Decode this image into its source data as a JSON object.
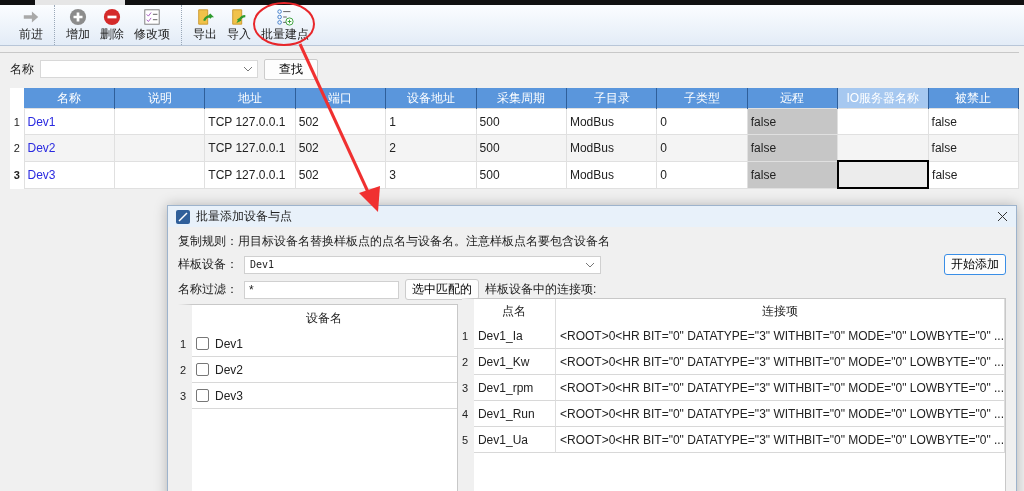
{
  "toolbar": {
    "groups": [
      [
        {
          "label": "前进",
          "kind": "forward"
        }
      ],
      [
        {
          "label": "增加",
          "kind": "add"
        },
        {
          "label": "删除",
          "kind": "delete"
        },
        {
          "label": "修改项",
          "kind": "edit"
        }
      ],
      [
        {
          "label": "导出",
          "kind": "export"
        },
        {
          "label": "导入",
          "kind": "import"
        },
        {
          "label": "批量建点",
          "kind": "batch"
        }
      ]
    ]
  },
  "search": {
    "label": "名称",
    "button": "查找"
  },
  "table": {
    "columns": [
      {
        "label": "名称",
        "selected": false
      },
      {
        "label": "说明",
        "selected": false
      },
      {
        "label": "地址",
        "selected": false
      },
      {
        "label": "端口",
        "selected": false
      },
      {
        "label": "设备地址",
        "selected": false
      },
      {
        "label": "采集周期",
        "selected": false
      },
      {
        "label": "子目录",
        "selected": false
      },
      {
        "label": "子类型",
        "selected": false
      },
      {
        "label": "远程",
        "selected": false
      },
      {
        "label": "IO服务器名称",
        "selected": true
      },
      {
        "label": "被禁止",
        "selected": false
      }
    ],
    "rows": [
      {
        "number": "1",
        "current": false,
        "cells": [
          "Dev1",
          "",
          "TCP 127.0.0.1",
          "502",
          "1",
          "500",
          "ModBus",
          "0",
          "false",
          "",
          "false"
        ]
      },
      {
        "number": "2",
        "current": false,
        "cells": [
          "Dev2",
          "",
          "TCP 127.0.0.1",
          "502",
          "2",
          "500",
          "ModBus",
          "0",
          "false",
          "",
          "false"
        ]
      },
      {
        "number": "3",
        "current": true,
        "cells": [
          "Dev3",
          "",
          "TCP 127.0.0.1",
          "502",
          "3",
          "500",
          "ModBus",
          "0",
          "false",
          "",
          "false"
        ]
      }
    ]
  },
  "dialog": {
    "title": "批量添加设备与点",
    "rule": "复制规则：用目标设备名替换样板点的点名与设备名。注意样板点名要包含设备名",
    "template_label": "样板设备：",
    "template_value": "Dev1",
    "start_button": "开始添加",
    "filter_label": "名称过滤：",
    "filter_value": "*",
    "select_button": "选中匹配的",
    "points_label": "样板设备中的连接项:",
    "devices": {
      "column": "设备名",
      "rows": [
        {
          "number": "1",
          "name": "Dev1",
          "checked": false
        },
        {
          "number": "2",
          "name": "Dev2",
          "checked": false
        },
        {
          "number": "3",
          "name": "Dev3",
          "checked": false
        }
      ]
    },
    "points": {
      "columns": [
        "点名",
        "连接项"
      ],
      "rows": [
        {
          "number": "1",
          "name": "Dev1_Ia",
          "link": "<ROOT>0<HR BIT=\"0\" DATATYPE=\"3\" WITHBIT=\"0\" MODE=\"0\" LOWBYTE=\"0\" ..."
        },
        {
          "number": "2",
          "name": "Dev1_Kw",
          "link": "<ROOT>0<HR BIT=\"0\" DATATYPE=\"3\" WITHBIT=\"0\" MODE=\"0\" LOWBYTE=\"0\" ..."
        },
        {
          "number": "3",
          "name": "Dev1_rpm",
          "link": "<ROOT>0<HR BIT=\"0\" DATATYPE=\"3\" WITHBIT=\"0\" MODE=\"0\" LOWBYTE=\"0\" ..."
        },
        {
          "number": "4",
          "name": "Dev1_Run",
          "link": "<ROOT>0<HR BIT=\"0\" DATATYPE=\"3\" WITHBIT=\"0\" MODE=\"0\" LOWBYTE=\"0\" ..."
        },
        {
          "number": "5",
          "name": "Dev1_Ua",
          "link": "<ROOT>0<HR BIT=\"0\" DATATYPE=\"3\" WITHBIT=\"0\" MODE=\"0\" LOWBYTE=\"0\" ..."
        }
      ]
    }
  }
}
